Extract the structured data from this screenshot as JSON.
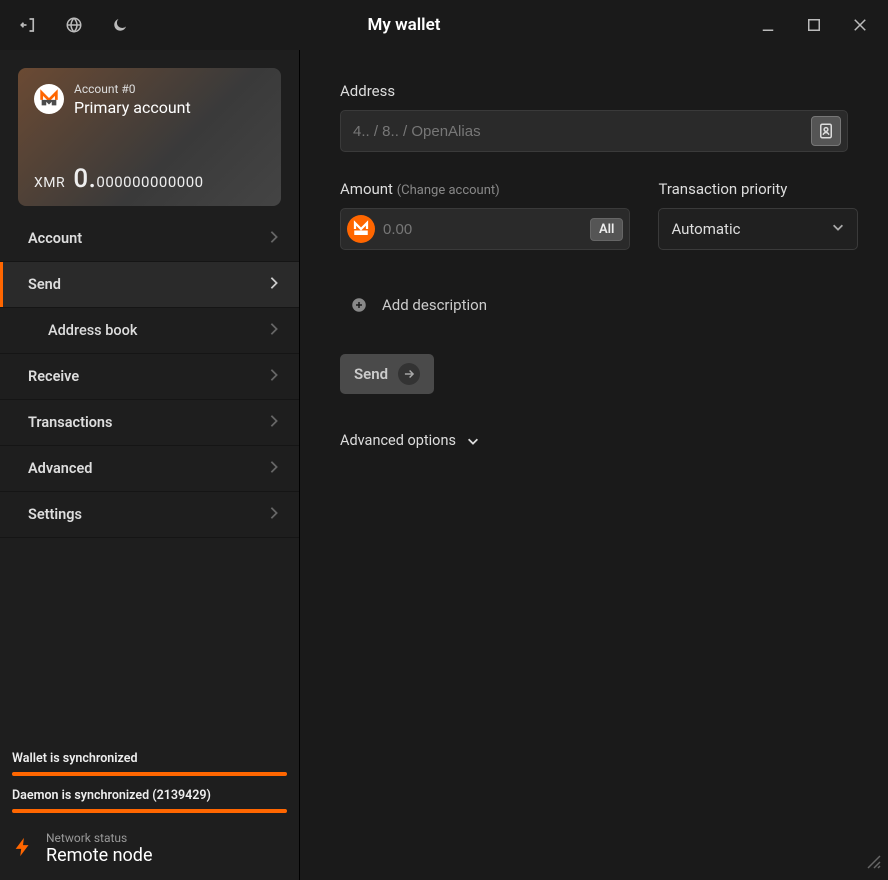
{
  "window": {
    "title": "My wallet"
  },
  "account": {
    "label": "Account #0",
    "name": "Primary account",
    "ticker": "XMR",
    "balance_int": "0.",
    "balance_frac": "000000000000"
  },
  "nav": {
    "account": "Account",
    "send": "Send",
    "address_book": "Address book",
    "receive": "Receive",
    "transactions": "Transactions",
    "advanced": "Advanced",
    "settings": "Settings"
  },
  "sync": {
    "wallet_label": "Wallet is synchronized",
    "wallet_pct": 100,
    "daemon_label": "Daemon is synchronized (2139429)",
    "daemon_pct": 100
  },
  "network": {
    "status_label": "Network status",
    "status_value": "Remote node"
  },
  "send": {
    "address_label": "Address",
    "address_placeholder": "4.. / 8.. / OpenAlias",
    "amount_label": "Amount",
    "change_account": "(Change account)",
    "amount_placeholder": "0.00",
    "all_button": "All",
    "priority_label": "Transaction priority",
    "priority_value": "Automatic",
    "add_description": "Add description",
    "send_button": "Send",
    "advanced_options": "Advanced options"
  }
}
